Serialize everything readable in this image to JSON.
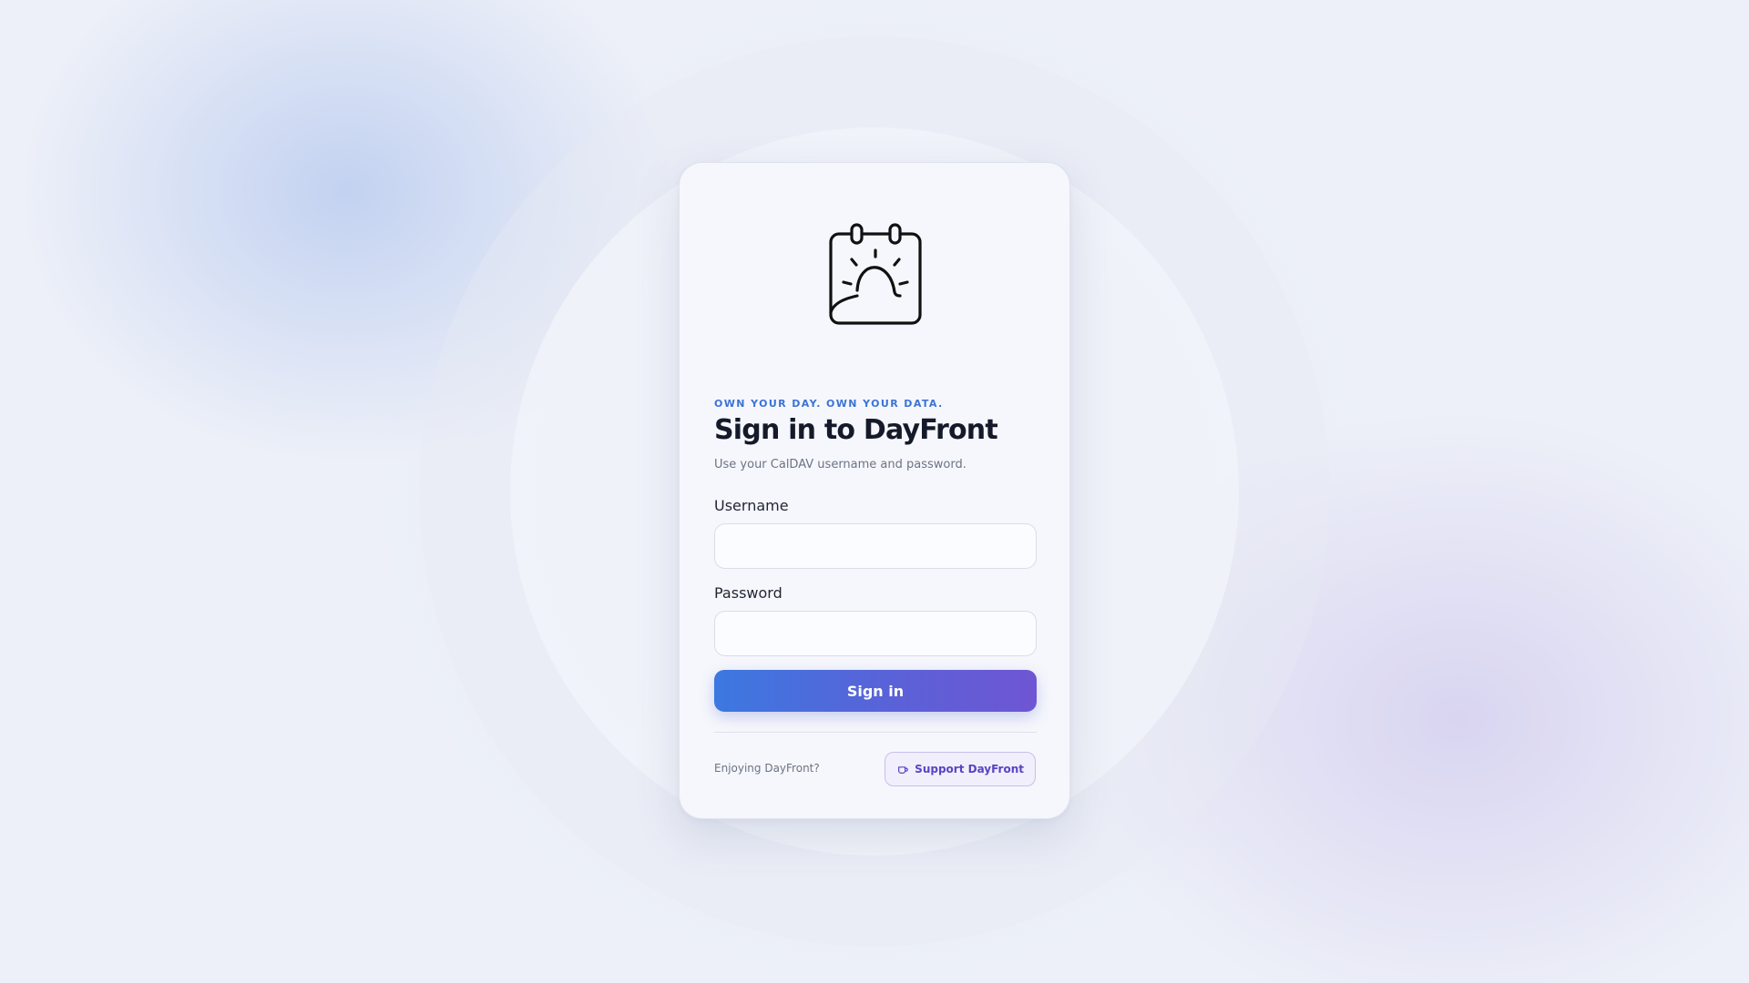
{
  "login": {
    "logo_icon": "calendar-sunrise-icon",
    "tagline": "OWN YOUR DAY. OWN YOUR DATA.",
    "title": "Sign in to DayFront",
    "subtitle": "Use your CalDAV username and password.",
    "username_label": "Username",
    "username_value": "",
    "password_label": "Password",
    "password_value": "",
    "sign_in_label": "Sign in"
  },
  "footer": {
    "prompt": "Enjoying DayFront?",
    "support_icon": "coffee-cup-icon",
    "support_label": "Support DayFront"
  },
  "colors": {
    "accent_blue": "#3b73d6",
    "accent_purple": "#6f55d3",
    "title_text": "#151a2a",
    "muted_text": "#6b7384"
  }
}
